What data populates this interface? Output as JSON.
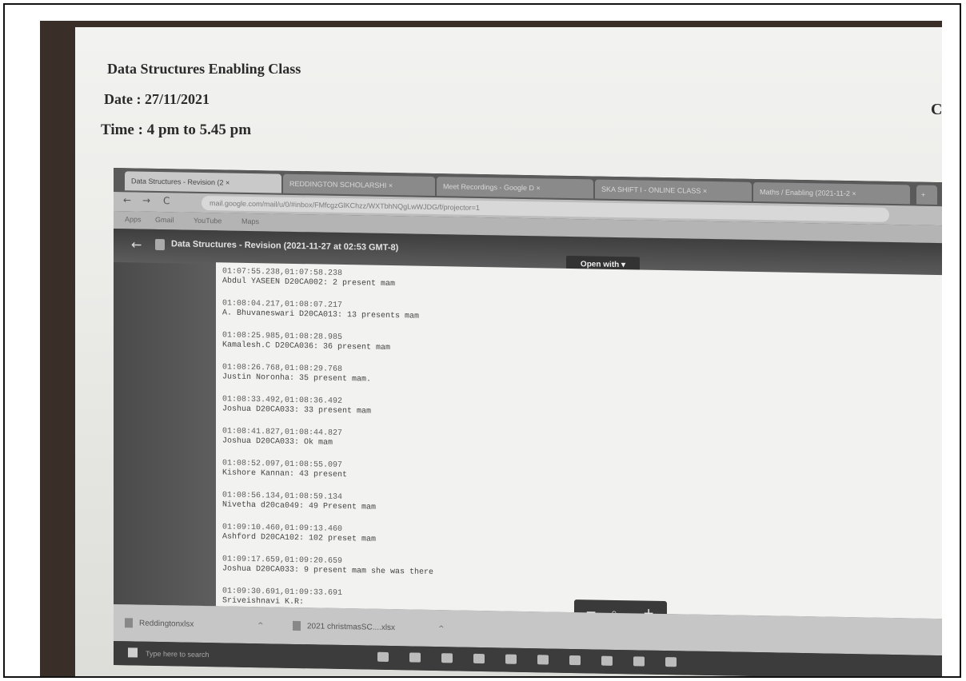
{
  "header": {
    "title": "Data Structures Enabling Class",
    "date": "Date : 27/11/2021",
    "time": "Time : 4 pm to 5.45 pm",
    "right_fragment": "C"
  },
  "browser": {
    "tabs": [
      {
        "label": "Data Structures - Revision (2 ×"
      },
      {
        "label": "REDDINGTON SCHOLARSHI ×"
      },
      {
        "label": "Meet Recordings - Google D ×"
      },
      {
        "label": "SKA SHIFT I - ONLINE CLASS ×"
      },
      {
        "label": "Maths / Enabling (2021-11-2 ×"
      }
    ],
    "new_tab": "+",
    "url": "mail.google.com/mail/u/0/#inbox/FMfcgzGlKChzz/WXTbhNQgLwWJDG/f/projector=1",
    "bookmarks": [
      "Apps",
      "Gmail",
      "YouTube",
      "Maps"
    ]
  },
  "viewer": {
    "back": "←",
    "title": "Data Structures - Revision (2021-11-27 at 02:53 GMT-8)",
    "open_with": "Open with ▾",
    "entries": [
      {
        "ts": "01:07:55.238,01:07:58.238",
        "text": "Abdul YASEEN D20CA002: 2 present mam"
      },
      {
        "ts": "01:08:04.217,01:08:07.217",
        "text": "A. Bhuvaneswari D20CA013: 13 presents mam"
      },
      {
        "ts": "01:08:25.985,01:08:28.985",
        "text": "Kamalesh.C D20CA036: 36 present mam"
      },
      {
        "ts": "01:08:26.768,01:08:29.768",
        "text": "Justin Noronha: 35 present mam."
      },
      {
        "ts": "01:08:33.492,01:08:36.492",
        "text": "Joshua D20CA033: 33 present mam"
      },
      {
        "ts": "01:08:41.827,01:08:44.827",
        "text": "Joshua D20CA033: Ok mam"
      },
      {
        "ts": "01:08:52.097,01:08:55.097",
        "text": "Kishore Kannan: 43 present"
      },
      {
        "ts": "01:08:56.134,01:08:59.134",
        "text": "Nivetha d20ca049: 49 Present mam"
      },
      {
        "ts": "01:09:10.460,01:09:13.460",
        "text": "Ashford D20CA102: 102 preset mam"
      },
      {
        "ts": "01:09:17.659,01:09:20.659",
        "text": "Joshua D20CA033: 9 present mam she was there"
      },
      {
        "ts": "01:09:30.691,01:09:33.691",
        "text": "Sriveishnavi K.R:"
      }
    ],
    "zoom_out": "−",
    "zoom_icon": "magnifier-icon",
    "zoom_in": "+"
  },
  "downloads": [
    {
      "name": "Reddingtonxlsx"
    },
    {
      "name": "2021 christmasSC....xlsx"
    }
  ],
  "taskbar": {
    "search_placeholder": "Type here to search"
  }
}
